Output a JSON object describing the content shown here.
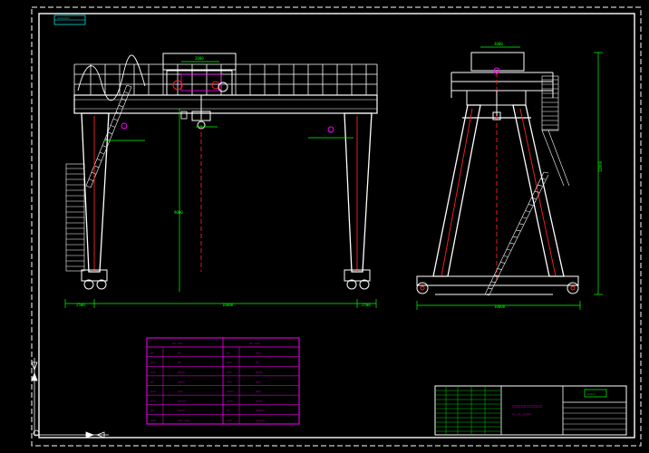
{
  "drawing": {
    "background": "#000000",
    "border_color": "#ffffff",
    "structure_color": "#ffffff",
    "centerline_color": "#ff2020",
    "dimension_color": "#00ff00",
    "trolley_color": "#ff00ff",
    "title_block_color": "#00ff00",
    "param_table_color": "#ff00ff",
    "top_left_stamp": "▭▭▭▭▭▭▭",
    "title_block_stamp": "▭▭▭▭▭"
  },
  "front_view": {
    "dim_top": "2000",
    "dim_span": "16000",
    "dim_left_leg": "2500",
    "dim_right_leg": "2500",
    "dim_height": "9000"
  },
  "side_view": {
    "dim_top": "3000",
    "dim_base": "10000",
    "dim_height": "12000"
  },
  "param_table": {
    "headers": [
      "▭▭ ▭▭▭",
      "▭▭ ▭▭▭"
    ],
    "rows": [
      [
        "▭▭",
        "▭▭",
        "▭▭",
        "▭▭▭"
      ],
      [
        "▭▭▭",
        "▭▭",
        "▭▭▭",
        "▭▭"
      ],
      [
        "▭▭▭",
        "▭▭▭▭",
        "▭▭▭",
        "▭▭▭▭"
      ],
      [
        "▭▭",
        "▭▭▭▭",
        "▭▭▭",
        "▭▭▭"
      ],
      [
        "▭▭▭",
        "▭▭▭",
        "▭▭▭▭",
        "▭▭▭"
      ],
      [
        "▭▭▭",
        "▭▭▭▭▭",
        "▭▭▭▭",
        "▭▭▭▭"
      ],
      [
        "▭▭",
        "▭▭▭▭",
        "▭▭",
        "▭▭▭▭▭"
      ],
      [
        "▭▭▭",
        "▭▭▭ ▭▭▭",
        "▭▭▭",
        "▭▭▭▭▭"
      ]
    ]
  },
  "title_block": {
    "title": "▭▭▭▭▭▭▭",
    "subtitle": "▭▭ ▭▭ ▭▭▭▭▭"
  }
}
